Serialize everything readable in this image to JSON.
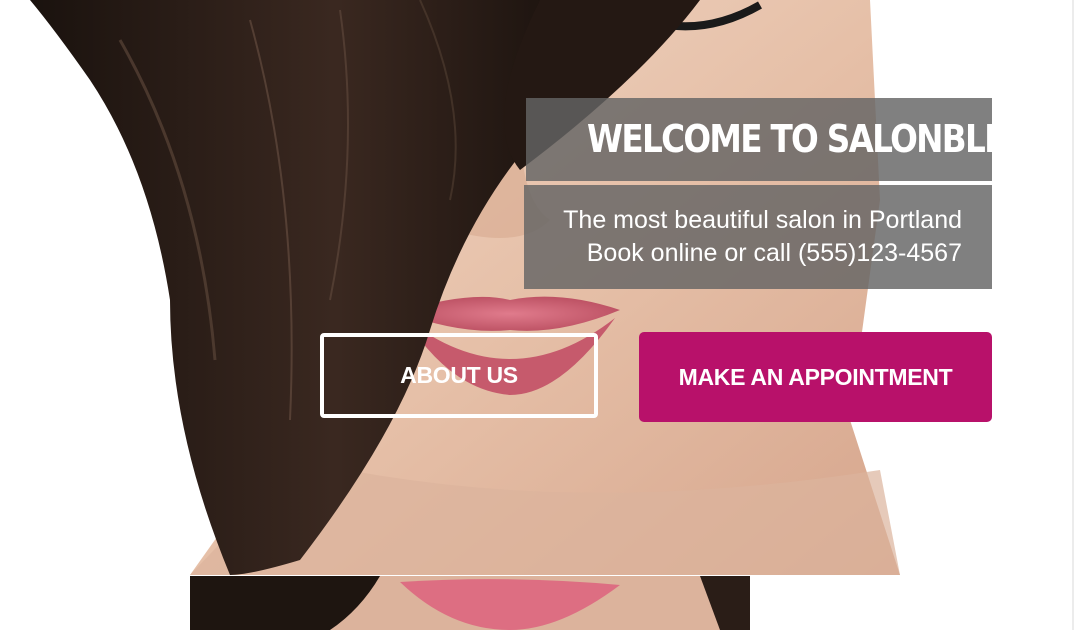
{
  "hero": {
    "title": "WELCOME TO SALONBLISS",
    "tagline_line1": "The most beautiful salon in Portland",
    "tagline_line2": "Book online or call (555)123-4567",
    "image_alt": "woman with dark hair covering one eye"
  },
  "buttons": {
    "about": "ABOUT US",
    "appointment": "MAKE AN APPOINTMENT"
  },
  "colors": {
    "accent": "#b8116a",
    "panel": "#646464",
    "text": "#ffffff"
  }
}
